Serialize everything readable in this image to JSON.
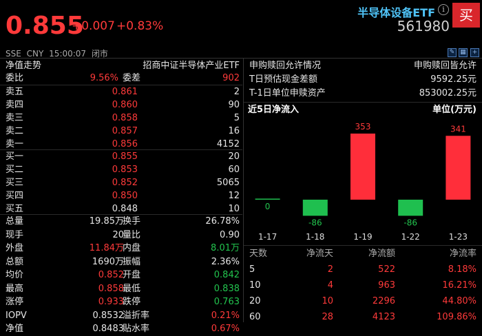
{
  "quote": {
    "price": "0.855",
    "change": "+0.007",
    "change_pct": "+0.83%",
    "name": "半导体设备ETF",
    "code": "561980",
    "buy_label": "买",
    "info_icon": "info-icon"
  },
  "status": {
    "market": "SSE",
    "currency": "CNY",
    "time": "15:00:07",
    "state": "闭市"
  },
  "left": {
    "nav_label": "净值走势",
    "index_name": "招商中证半导体产业ETF",
    "weibi_label": "委比",
    "weibi_value": "9.56%",
    "weicha_label": "委差",
    "weicha_value": "902",
    "asks": [
      {
        "label": "卖五",
        "price": "0.861",
        "vol": "2"
      },
      {
        "label": "卖四",
        "price": "0.860",
        "vol": "90"
      },
      {
        "label": "卖三",
        "price": "0.858",
        "vol": "5"
      },
      {
        "label": "卖二",
        "price": "0.857",
        "vol": "16"
      },
      {
        "label": "卖一",
        "price": "0.856",
        "vol": "4152"
      }
    ],
    "bids": [
      {
        "label": "买一",
        "price": "0.855",
        "vol": "20"
      },
      {
        "label": "买二",
        "price": "0.853",
        "vol": "60"
      },
      {
        "label": "买三",
        "price": "0.852",
        "vol": "5065"
      },
      {
        "label": "买四",
        "price": "0.850",
        "vol": "12"
      },
      {
        "label": "买五",
        "price": "0.848",
        "vol": "10"
      }
    ],
    "stats": [
      {
        "l1": "总量",
        "v1": "19.85万",
        "l2": "换手",
        "v2": "26.78%"
      },
      {
        "l1": "现手",
        "v1": "20",
        "l2": "量比",
        "v2": "0.90"
      },
      {
        "l1": "外盘",
        "v1": "11.84万",
        "l2": "内盘",
        "v2": "8.01万"
      },
      {
        "l1": "总额",
        "v1": "1690万",
        "l2": "振幅",
        "v2": "2.36%"
      },
      {
        "l1": "均价",
        "v1": "0.852",
        "l2": "开盘",
        "v2": "0.842"
      },
      {
        "l1": "最高",
        "v1": "0.858",
        "l2": "最低",
        "v2": "0.838"
      },
      {
        "l1": "涨停",
        "v1": "0.933",
        "l2": "跌停",
        "v2": "0.763"
      },
      {
        "l1": "IOPV",
        "v1": "0.8532",
        "l2": "溢折率",
        "v2": "0.21%"
      },
      {
        "l1": "净值",
        "v1": "0.8483",
        "l2": "贴水率",
        "v2": "0.67%"
      }
    ]
  },
  "right": {
    "subscribe_label": "申购赎回允许情况",
    "subscribe_value": "申购赎回皆允许",
    "cash_label": "T日预估现金差额",
    "cash_value": "9592.25元",
    "asset_label": "T-1日单位申赎资产",
    "asset_value": "853002.25元",
    "flow_title": "近5日净流入",
    "flow_unit": "单位(万元)",
    "table_headers": [
      "天数",
      "净流天",
      "净流额",
      "净流率"
    ],
    "table_rows": [
      [
        "5",
        "2",
        "522",
        "8.18%"
      ],
      [
        "10",
        "4",
        "963",
        "16.21%"
      ],
      [
        "20",
        "10",
        "2296",
        "44.80%"
      ],
      [
        "60",
        "28",
        "4123",
        "109.86%"
      ]
    ]
  },
  "chart_data": {
    "type": "bar",
    "title": "近5日净流入",
    "unit": "单位(万元)",
    "categories": [
      "1-17",
      "1-18",
      "1-19",
      "1-22",
      "1-23"
    ],
    "values": [
      0,
      -86,
      353,
      -86,
      341
    ],
    "colors": {
      "positive": "#ff2e3a",
      "negative": "#1fbf4f",
      "zero": "#1fbf4f"
    }
  },
  "colors": {
    "up": "#ff3a3a",
    "down": "#22c44e",
    "title": "#4fc3f7",
    "buy_button": "#d9262b"
  }
}
